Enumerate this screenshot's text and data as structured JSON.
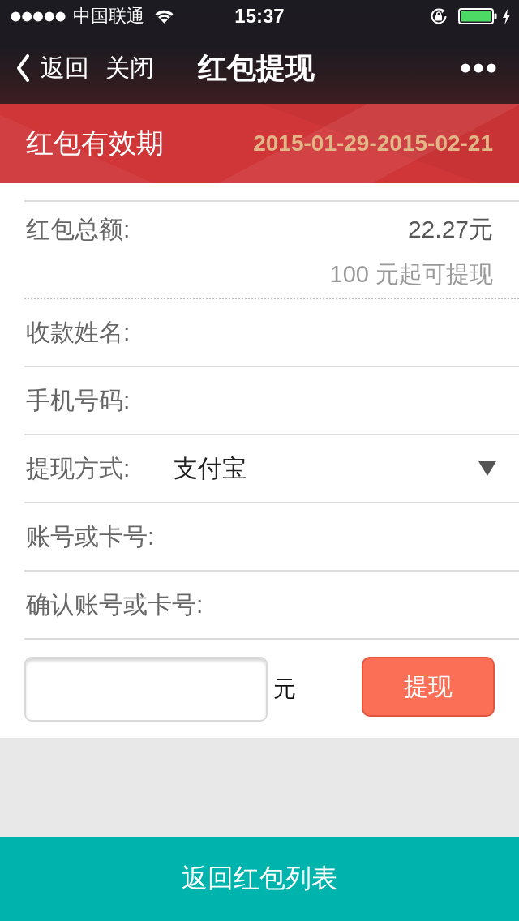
{
  "status_bar": {
    "carrier": "中国联通",
    "time": "15:37"
  },
  "nav_bar": {
    "back": "返回",
    "close": "关闭",
    "title": "红包提现"
  },
  "validity": {
    "label": "红包有效期",
    "dates": "2015-01-29-2015-02-21"
  },
  "summary": {
    "label": "红包总额:",
    "amount": "22.27元",
    "hint": "100 元起可提现"
  },
  "fields": [
    {
      "kind": "text",
      "label": "收款姓名:"
    },
    {
      "kind": "text",
      "label": "手机号码:"
    },
    {
      "kind": "select",
      "label": "提现方式:",
      "value": "支付宝"
    },
    {
      "kind": "text",
      "label": "账号或卡号:"
    },
    {
      "kind": "text",
      "label": "确认账号或卡号:"
    }
  ],
  "withdraw": {
    "unit": "元",
    "button": "提现"
  },
  "footer_button": "返回红包列表"
}
